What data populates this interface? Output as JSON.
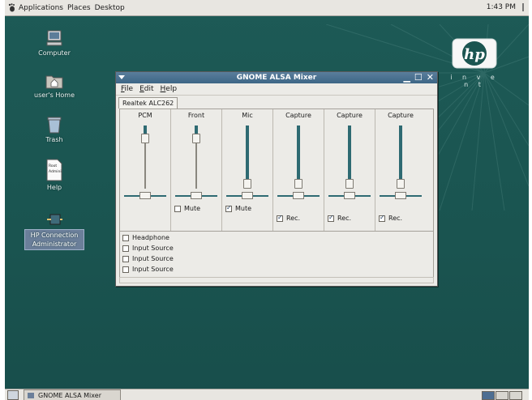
{
  "top_panel": {
    "menus": [
      "Applications",
      "Places",
      "Desktop"
    ],
    "clock": "1:43 PM"
  },
  "desktop": {
    "icons": [
      {
        "label": "Computer",
        "icon": "computer-icon"
      },
      {
        "label": "user's Home",
        "icon": "home-folder-icon"
      },
      {
        "label": "Trash",
        "icon": "trash-icon"
      },
      {
        "label": "Help",
        "icon": "help-document-icon",
        "doc_text_1": "Root",
        "doc_text_2": "Admini"
      },
      {
        "label": "HP Connection Administrator",
        "icon": "connection-admin-icon"
      }
    ],
    "logo": {
      "mark": "hp",
      "tagline": "i n v e n t"
    }
  },
  "window": {
    "title": "GNOME ALSA Mixer",
    "menus": [
      "File",
      "Edit",
      "Help"
    ],
    "tab": "Realtek ALC262",
    "channels": [
      {
        "name": "PCM",
        "level": 0.85,
        "switch": null
      },
      {
        "name": "Front",
        "level": 0.85,
        "switch": {
          "label": "Mute",
          "checked": false
        }
      },
      {
        "name": "Mic",
        "level": 0.0,
        "switch": {
          "label": "Mute",
          "checked": true
        }
      },
      {
        "name": "Capture",
        "level": 0.0,
        "switch": {
          "label": "Rec.",
          "checked": true
        }
      },
      {
        "name": "Capture",
        "level": 0.0,
        "switch": {
          "label": "Rec.",
          "checked": true
        }
      },
      {
        "name": "Capture",
        "level": 0.0,
        "switch": {
          "label": "Rec.",
          "checked": true
        }
      }
    ],
    "options": [
      {
        "label": "Headphone",
        "checked": false
      },
      {
        "label": "Input Source",
        "checked": false
      },
      {
        "label": "Input Source",
        "checked": false
      },
      {
        "label": "Input Source",
        "checked": false
      }
    ]
  },
  "taskbar": {
    "window_button": "GNOME ALSA Mixer"
  },
  "colors": {
    "desktop": "#1b5551",
    "titlebar": "#3d6686",
    "slider_fill": "#2e6a72"
  }
}
